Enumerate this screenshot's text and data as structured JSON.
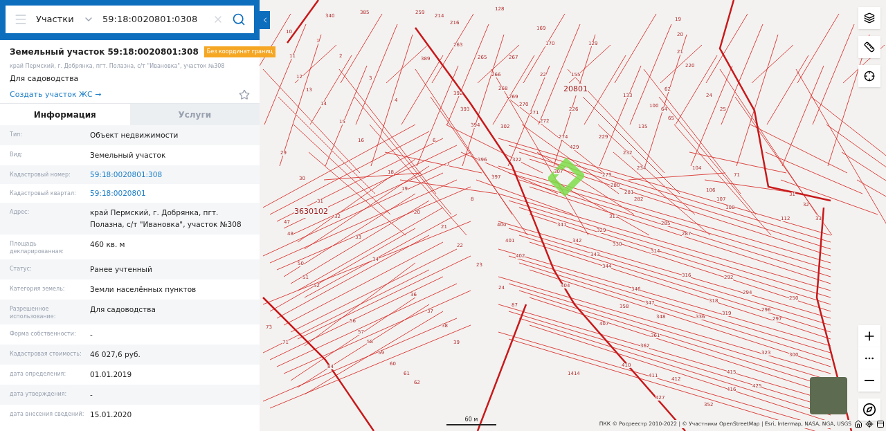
{
  "search": {
    "category": "Участки",
    "value": "59:18:0020801:0308"
  },
  "card": {
    "title": "Земельный участок 59:18:0020801:308",
    "badge": "Без координат границ",
    "address": "край Пермский, г. Добрянка, пгт. Полазна, с/т \"Ивановка\", участок №308",
    "purpose": "Для садоводства",
    "link": "Создать участок ЖС →",
    "favorite": false
  },
  "tabs": [
    {
      "label": "Информация",
      "selected": true
    },
    {
      "label": "Услуги",
      "selected": false
    }
  ],
  "fields": [
    {
      "label": "Тип:",
      "value": "Объект недвижимости",
      "kind": "text"
    },
    {
      "label": "Вид:",
      "value": "Земельный участок",
      "kind": "text"
    },
    {
      "label": "Кадастровый номер:",
      "value": "59:18:0020801:308",
      "kind": "link"
    },
    {
      "label": "Кадастровый квартал:",
      "value": "59:18:0020801",
      "kind": "link"
    },
    {
      "label": "Адрес:",
      "value": "край Пермский, г. Добрянка, пгт. Полазна, с/т \"Ивановка\", участок №308",
      "kind": "text"
    },
    {
      "label": "Площадь декларированная:",
      "value": "460 кв. м",
      "kind": "text"
    },
    {
      "label": "Статус:",
      "value": "Ранее учтенный",
      "kind": "text"
    },
    {
      "label": "Категория земель:",
      "value": "Земли населённых пунктов",
      "kind": "text"
    },
    {
      "label": "Разрешенное использование:",
      "value": "Для садоводства",
      "kind": "text"
    },
    {
      "label": "Форма собственности:",
      "value": "-",
      "kind": "text"
    },
    {
      "label": "Кадастровая стоимость:",
      "value": "46 027,6 руб.",
      "kind": "text"
    },
    {
      "label": "дата определения:",
      "value": "01.01.2019",
      "kind": "text"
    },
    {
      "label": "дата утверждения:",
      "value": "-",
      "kind": "text"
    },
    {
      "label": "дата внесения сведений:",
      "value": "15.01.2020",
      "kind": "text"
    }
  ],
  "map": {
    "quarters": [
      "20801",
      "3630102"
    ],
    "parcels": [
      "340",
      "385",
      "259",
      "214",
      "216",
      "128",
      "19",
      "169",
      "20",
      "170",
      "21",
      "389",
      "263",
      "265",
      "266",
      "267",
      "220",
      "22",
      "155",
      "129",
      "133",
      "392",
      "393",
      "268",
      "269",
      "270",
      "271",
      "272",
      "226",
      "62",
      "24",
      "25",
      "394",
      "302",
      "274",
      "429",
      "229",
      "135",
      "100",
      "64",
      "65",
      "396",
      "397",
      "322",
      "307",
      "279",
      "232",
      "234",
      "104",
      "71",
      "106",
      "107",
      "108",
      "112",
      "31",
      "32",
      "33",
      "280",
      "281",
      "282",
      "285",
      "287",
      "400",
      "401",
      "402",
      "341",
      "342",
      "343",
      "329",
      "311",
      "330",
      "314",
      "344",
      "316",
      "292",
      "294",
      "318",
      "319",
      "336",
      "296",
      "297",
      "250",
      "404",
      "358",
      "347",
      "348",
      "346",
      "407",
      "361",
      "362",
      "410",
      "411",
      "412",
      "415",
      "416",
      "427",
      "352",
      "425",
      "323",
      "300",
      "1414",
      "3",
      "4",
      "14",
      "15",
      "16",
      "6",
      "7",
      "8",
      "18",
      "19",
      "20",
      "21",
      "22",
      "23",
      "24",
      "29",
      "30",
      "31",
      "32",
      "33",
      "34",
      "36",
      "37",
      "38",
      "39",
      "47",
      "48",
      "50",
      "51",
      "52",
      "56",
      "57",
      "58",
      "59",
      "60",
      "61",
      "62",
      "71",
      "73",
      "84",
      "87",
      "10",
      "11",
      "12",
      "13",
      "1",
      "2"
    ],
    "scale": "60 м",
    "attribution": "ПКК © Росреестр 2010-2022 | © Участники OpenStreetMap | Esri, Intermap, NASA, NGA, USGS"
  }
}
